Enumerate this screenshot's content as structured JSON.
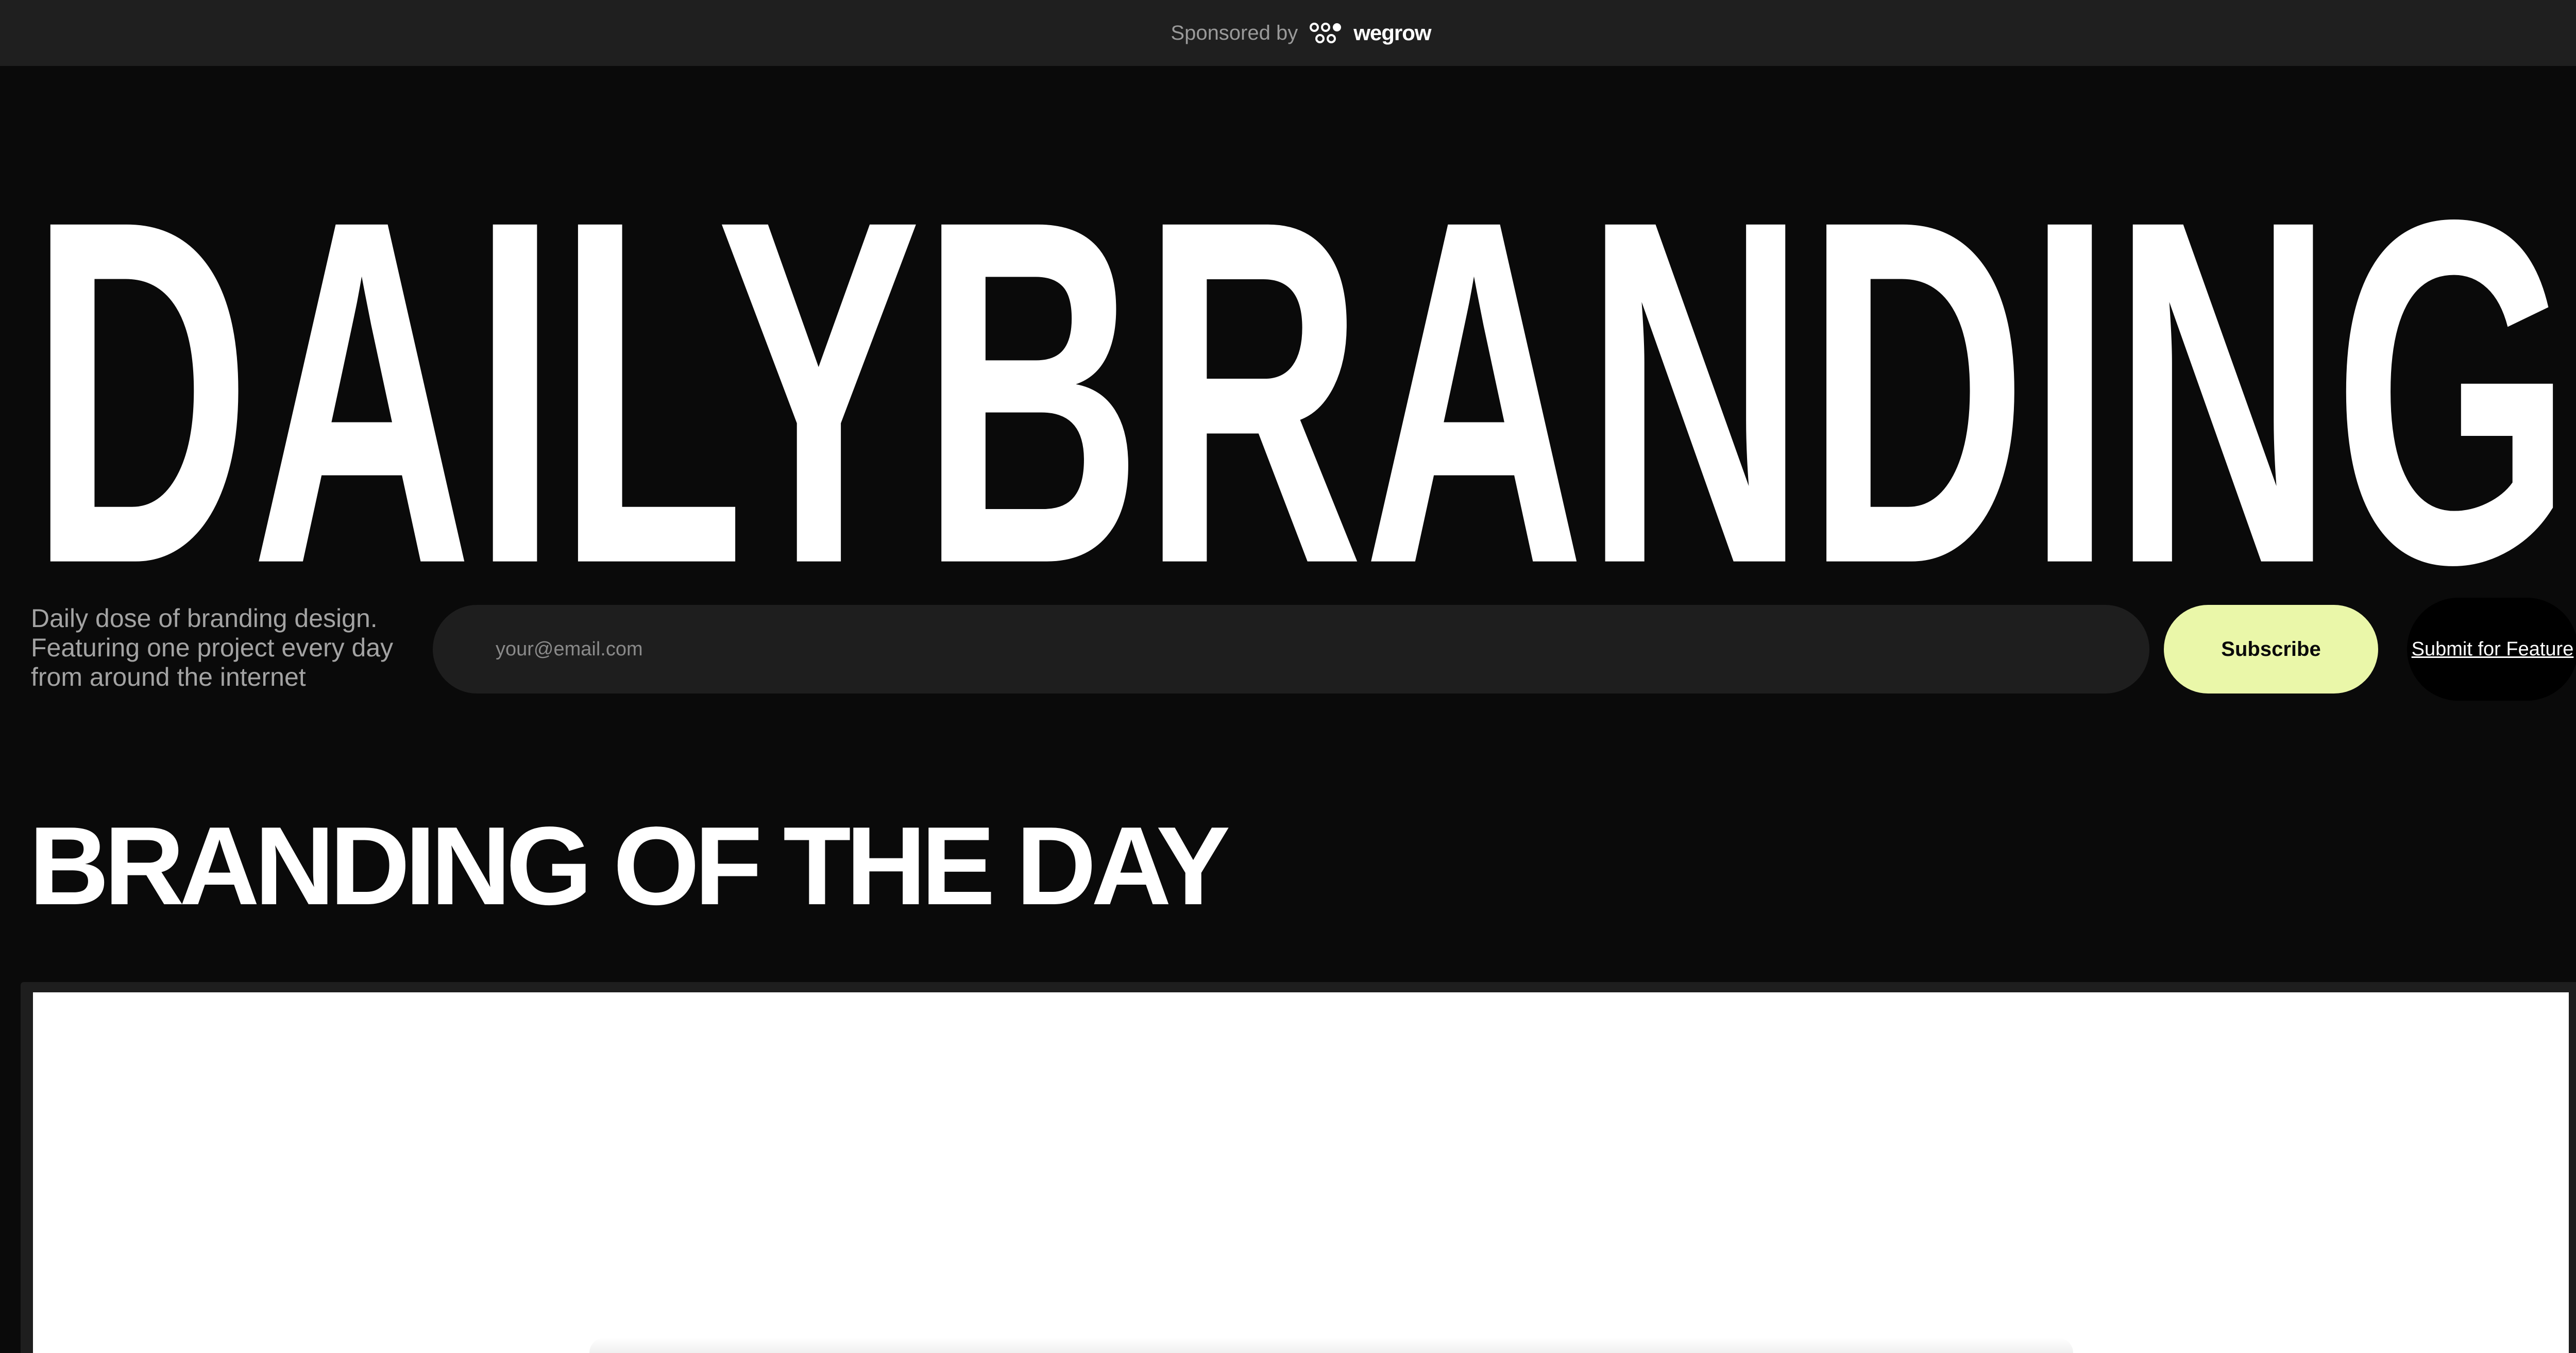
{
  "sponsor": {
    "label": "Sponsored by",
    "brand": "wegrow",
    "icon": "wegrow-logo-icon"
  },
  "hero": {
    "wordmark": "DAILYBRANDING",
    "tagline": [
      "Daily dose of branding design.",
      "Featuring one project every day",
      "from around the internet"
    ]
  },
  "subscribe": {
    "email_placeholder": "your@email.com",
    "email_value": "",
    "button_label": "Subscribe",
    "feature_link": "Submit for Feature"
  },
  "section": {
    "title": "BRANDING OF THE DAY"
  },
  "colors": {
    "background": "#0a0a0a",
    "bar": "#1f1f1f",
    "accent": "#eaf7a9",
    "text": "#ffffff",
    "muted": "#a3a3a3"
  }
}
